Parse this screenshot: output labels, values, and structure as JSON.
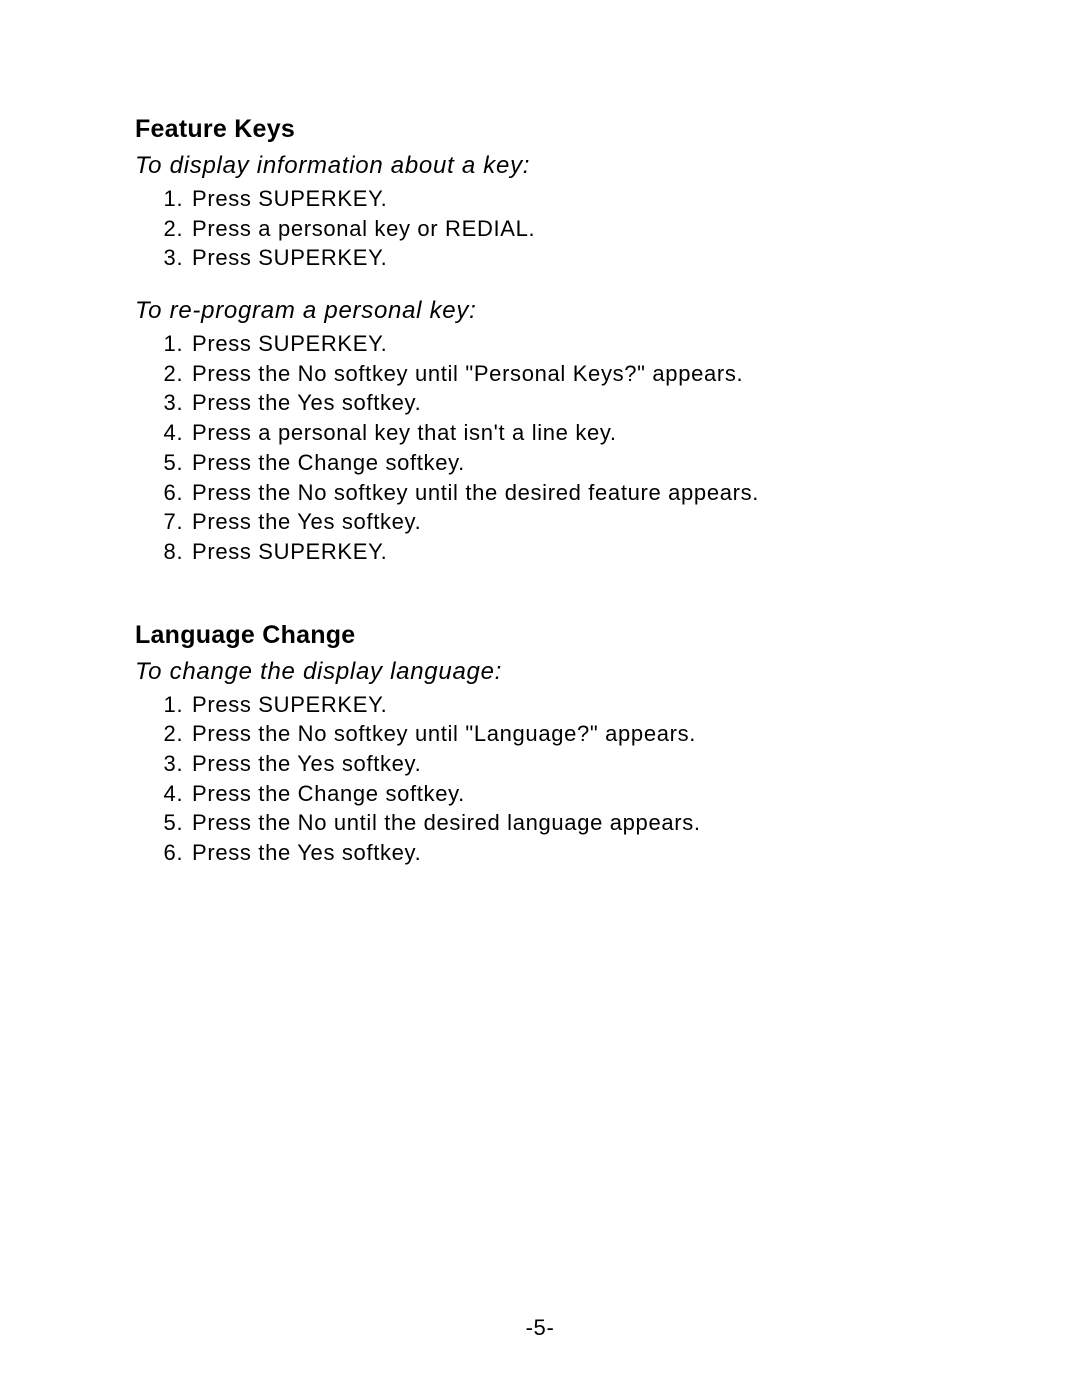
{
  "sections": [
    {
      "heading": "Feature Keys",
      "subsections": [
        {
          "subheading": "To display information about a key:",
          "steps": [
            "Press SUPERKEY.",
            "Press a personal key or REDIAL.",
            "Press SUPERKEY."
          ]
        },
        {
          "subheading": "To re-program a personal key:",
          "steps": [
            "Press SUPERKEY.",
            "Press the No softkey until \"Personal Keys?\" appears.",
            "Press the Yes softkey.",
            "Press a personal key that isn't a line key.",
            "Press the Change softkey.",
            "Press the No softkey until the desired feature appears.",
            "Press the Yes softkey.",
            "Press SUPERKEY."
          ]
        }
      ]
    },
    {
      "heading": "Language Change",
      "subsections": [
        {
          "subheading": "To change the display language:",
          "steps": [
            "Press SUPERKEY.",
            "Press the No softkey until \"Language?\" appears.",
            "Press the Yes softkey.",
            "Press the Change softkey.",
            "Press the No until the desired language appears.",
            "Press the Yes softkey."
          ]
        }
      ]
    }
  ],
  "page_number": "-5-"
}
